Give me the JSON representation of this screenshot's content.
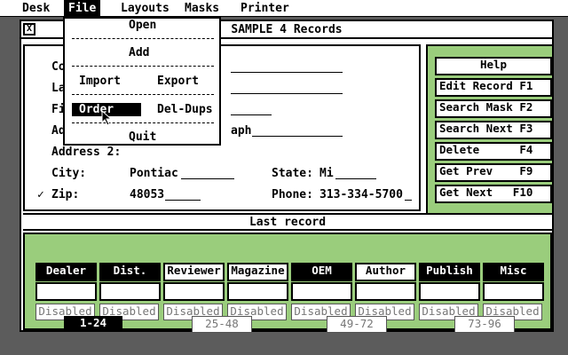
{
  "menubar": {
    "items": [
      "Desk",
      "File",
      "Layouts",
      "Masks",
      "Printer"
    ],
    "active": "File"
  },
  "file_menu": {
    "open": "Open",
    "add": "Add",
    "import": "Import",
    "export": "Export",
    "order": "Order",
    "del_dups": "Del-Dups",
    "quit": "Quit"
  },
  "window": {
    "close_glyph": "X",
    "title": "SAMPLE 4 Records"
  },
  "form": {
    "partial_labels": [
      "Co",
      "La",
      "Fi",
      "Ad"
    ],
    "address1_partial_value": "aph",
    "address2_label": "Address 2:",
    "city_label": "City:",
    "city_value": "Pontiac",
    "state_label": "State:",
    "state_value": "Mi",
    "zip_check": "✓",
    "zip_label": "Zip:",
    "zip_value": "48053",
    "phone_label": "Phone:",
    "phone_value": "313-334-5700"
  },
  "side_buttons": [
    {
      "label": "Help",
      "key": ""
    },
    {
      "label": "Edit Record",
      "key": "F1"
    },
    {
      "label": "Search Mask",
      "key": "F2"
    },
    {
      "label": "Search Next",
      "key": "F3"
    },
    {
      "label": "Delete",
      "key": "F4"
    },
    {
      "label": "Get Prev",
      "key": "F9"
    },
    {
      "label": "Get Next",
      "key": "F10"
    }
  ],
  "status": "Last record",
  "categories": [
    {
      "label": "Dealer",
      "style": "dark"
    },
    {
      "label": "Dist.",
      "style": "dark"
    },
    {
      "label": "Reviewer",
      "style": "light"
    },
    {
      "label": "Magazine",
      "style": "light"
    },
    {
      "label": "OEM",
      "style": "dark"
    },
    {
      "label": "Author",
      "style": "light"
    },
    {
      "label": "Publish",
      "style": "dark"
    },
    {
      "label": "Misc",
      "style": "dark"
    }
  ],
  "disabled_label": "Disabled",
  "pages": [
    {
      "label": "1-24",
      "active": true
    },
    {
      "label": "25-48",
      "active": false
    },
    {
      "label": "49-72",
      "active": false
    },
    {
      "label": "73-96",
      "active": false
    }
  ],
  "colors": {
    "panel_green": "#9acd7c",
    "desktop": "#5c5c5c"
  }
}
